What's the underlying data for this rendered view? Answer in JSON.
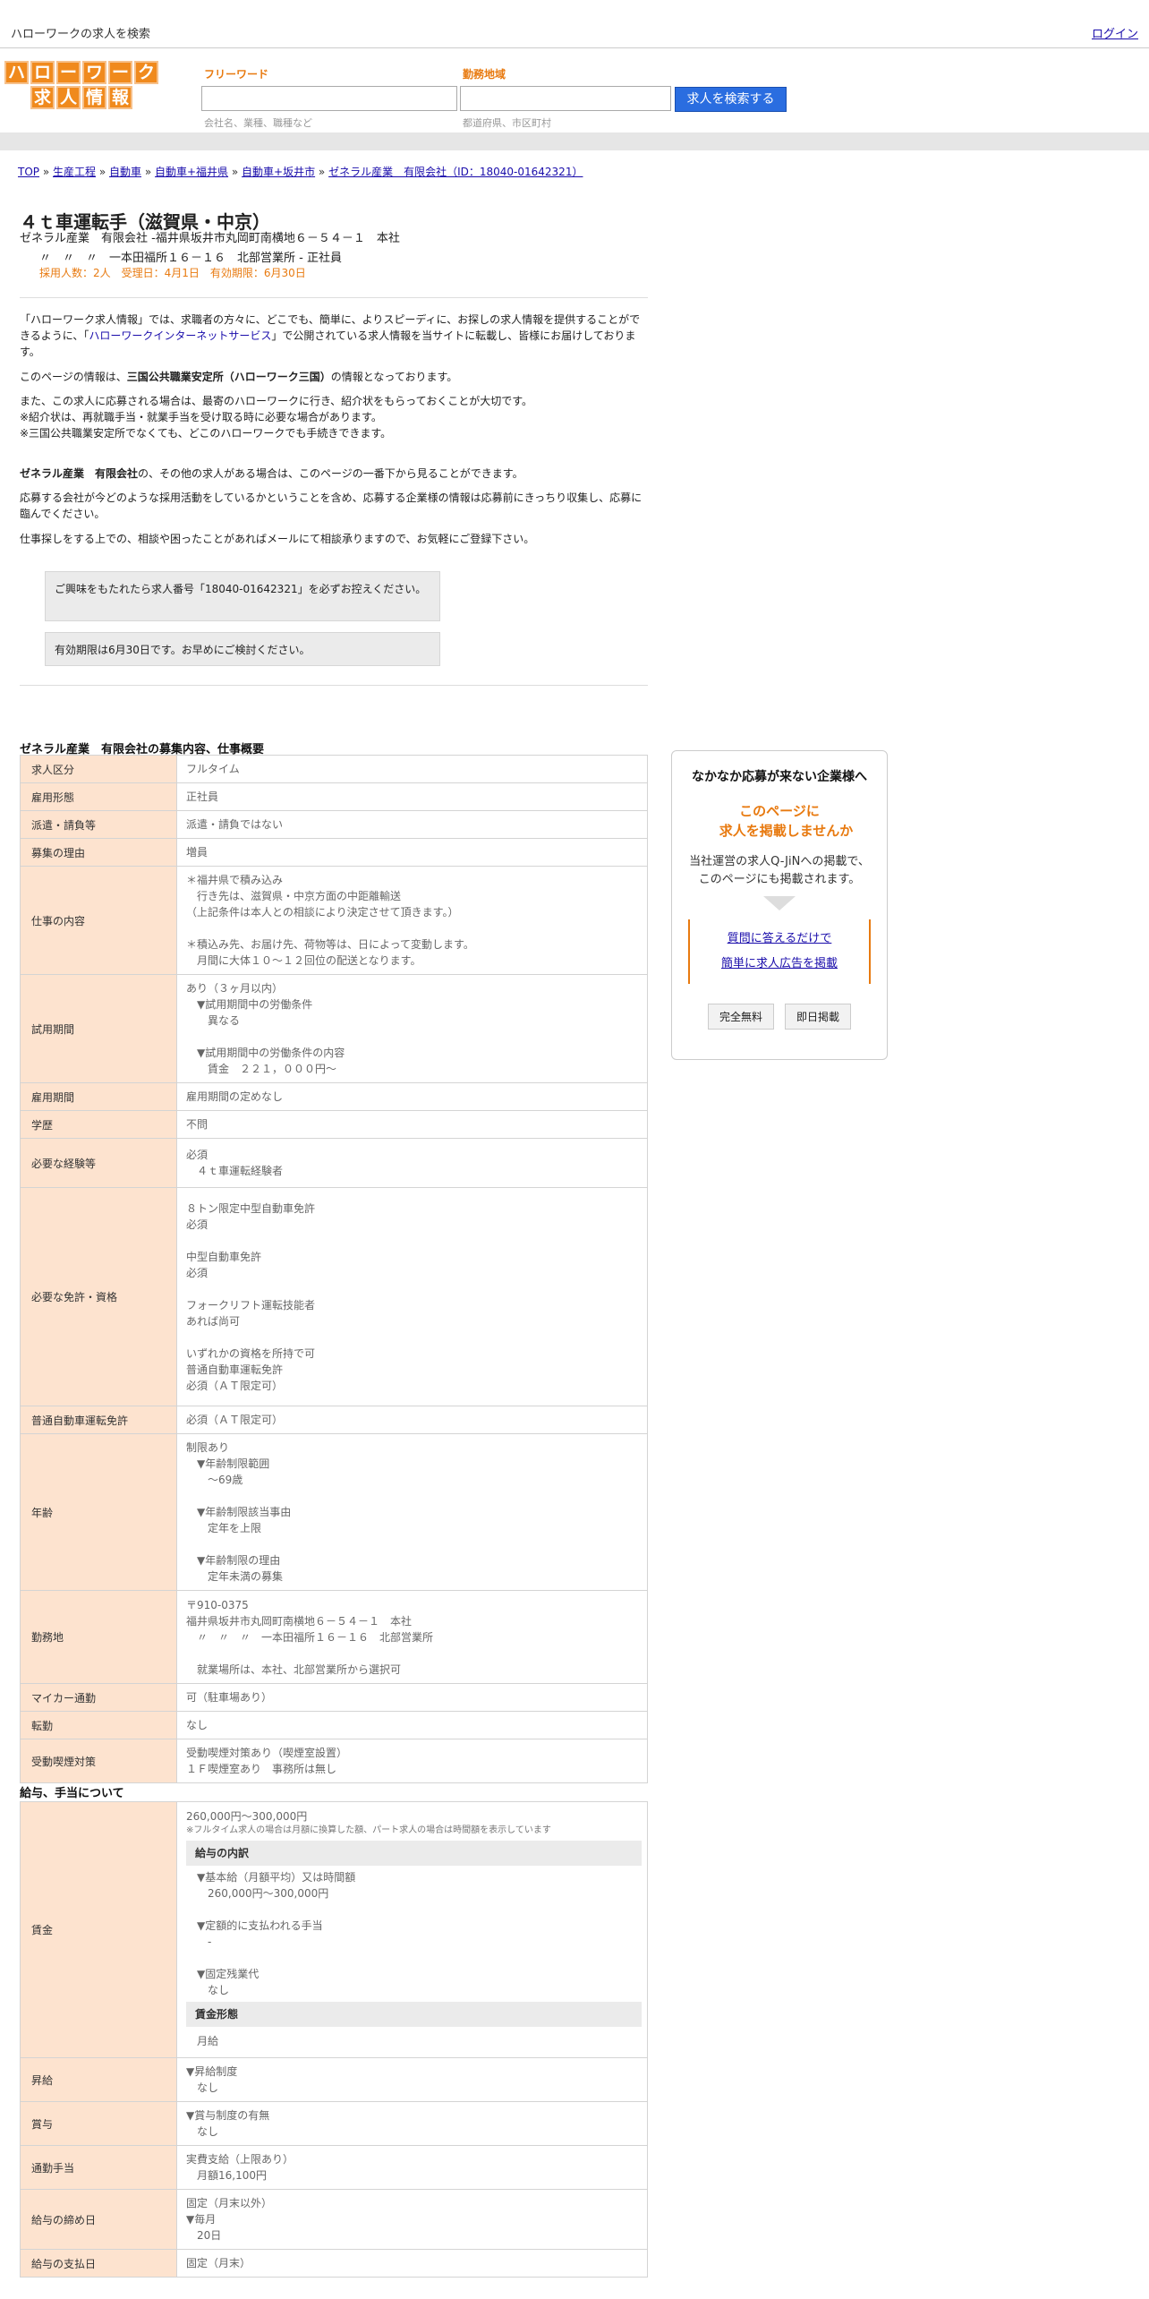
{
  "header": {
    "site_name": "ハローワークの求人を検索",
    "login": "ログイン"
  },
  "logo": {
    "row1": [
      "ハ",
      "ロ",
      "ー",
      "ワ",
      "ー",
      "ク"
    ],
    "row2": [
      "求",
      "人",
      "情",
      "報"
    ]
  },
  "search": {
    "keyword_label": "フリーワード",
    "keyword_hint": "会社名、業種、職種など",
    "area_label": "勤務地域",
    "area_hint": "都道府県、市区町村",
    "button": "求人を検索する"
  },
  "breadcrumb": {
    "items": [
      "TOP",
      "生産工程",
      "自動車",
      "自動車+福井県",
      "自動車+坂井市",
      "ゼネラル産業　有限会社（ID：18040-01642321）"
    ],
    "sep": " » "
  },
  "job": {
    "title": "４ｔ車運転手（滋賀県・中京）",
    "company_line": "ゼネラル産業　有限会社 -福井県坂井市丸岡町南横地６－５４－１　本社",
    "company_line2": "〃　〃　〃　一本田福所１６－１６　北部営業所 - 正社員",
    "meta": "採用人数：2人　受理日：4月1日　有効期限：6月30日"
  },
  "intro": {
    "p1a": "「ハローワーク求人情報」では、求職者の方々に、どこでも、簡単に、よりスピーディに、お探しの求人情報を提供することができるように、「",
    "p1_link": "ハローワークインターネットサービス",
    "p1b": "」で公開されている求人情報を当サイトに転載し、皆様にお届けしております。",
    "p2a": "このページの情報は、",
    "p2_bold": "三国公共職業安定所（ハローワーク三国）",
    "p2b": "の情報となっております。",
    "p3": "また、この求人に応募される場合は、最寄のハローワークに行き、紹介状をもらっておくことが大切です。\n※紹介状は、再就職手当・就業手当を受け取る時に必要な場合があります。\n※三国公共職業安定所でなくても、どこのハローワークでも手続きできます。",
    "p4_bold": "ゼネラル産業　有限会社",
    "p4b": "の、その他の求人がある場合は、このページの一番下から見ることができます。",
    "p5": "応募する会社が今どのような採用活動をしているかということを含め、応募する企業様の情報は応募前にきっちり収集し、応募に臨んでください。",
    "p6": "仕事探しをする上での、相談や困ったことがあればメールにて相談承りますので、お気軽にご登録下さい。",
    "note1": "ご興味をもたれたら求人番号「18040-01642321」を必ずお控えください。",
    "note2": "有効期限は6月30日です。お早めにご検討ください。"
  },
  "section1_title": "ゼネラル産業　有限会社の募集内容、仕事概要",
  "rows1": [
    {
      "k": "求人区分",
      "v": "フルタイム"
    },
    {
      "k": "雇用形態",
      "v": "正社員"
    },
    {
      "k": "派遣・請負等",
      "v": "派遣・請負ではない"
    },
    {
      "k": "募集の理由",
      "v": "増員"
    },
    {
      "k": "仕事の内容",
      "v": "＊福井県で積み込み\n　行き先は、滋賀県・中京方面の中距離輸送\n（上記条件は本人との相談により決定させて頂きます。）\n\n＊積込み先、お届け先、荷物等は、日によって変動します。\n　月間に大体１０～１２回位の配送となります。"
    },
    {
      "k": "試用期間",
      "v": "あり（３ヶ月以内）\n　▼試用期間中の労働条件\n　　異なる\n\n　▼試用期間中の労働条件の内容\n　　賃金　２２１，０００円～"
    },
    {
      "k": "雇用期間",
      "v": "雇用期間の定めなし"
    },
    {
      "k": "学歴",
      "v": "不問"
    },
    {
      "k": "必要な経験等",
      "v": "必須\n　４ｔ車運転経験者"
    },
    {
      "k": "必要な免許・資格",
      "v": "８トン限定中型自動車免許\n必須\n\n中型自動車免許\n必須\n\nフォークリフト運転技能者\nあれば尚可\n\nいずれかの資格を所持で可\n普通自動車運転免許\n必須（ＡＴ限定可）"
    },
    {
      "k": "普通自動車運転免許",
      "v": "必須（ＡＴ限定可）"
    },
    {
      "k": "年齢",
      "v": "制限あり\n　▼年齢制限範囲\n　　〜69歳\n\n　▼年齢制限該当事由\n　　定年を上限\n\n　▼年齢制限の理由\n　　定年未満の募集"
    },
    {
      "k": "勤務地",
      "v": "〒910-0375\n福井県坂井市丸岡町南横地６－５４－１　本社\n　〃　〃　〃　一本田福所１６－１６　北部営業所\n\n　就業場所は、本社、北部営業所から選択可"
    },
    {
      "k": "マイカー通勤",
      "v": "可（駐車場あり）"
    },
    {
      "k": "転勤",
      "v": "なし"
    },
    {
      "k": "受動喫煙対策",
      "v": "受動喫煙対策あり（喫煙室設置）\n１Ｆ喫煙室あり　事務所は無し"
    }
  ],
  "section2_title": "給与、手当について",
  "wage": {
    "k": "賃金",
    "amount": "260,000円〜300,000円",
    "note": "※フルタイム求人の場合は月額に換算した額、パート求人の場合は時間額を表示しています",
    "breakdown_title": "給与の内訳",
    "breakdown": "　▼基本給（月額平均）又は時間額\n　　260,000円〜300,000円\n\n　▼定額的に支払われる手当\n　　-\n\n　▼固定残業代\n　　なし",
    "form_title": "賃金形態",
    "form": "　月給"
  },
  "rows2": [
    {
      "k": "昇給",
      "v": "▼昇給制度\n　なし"
    },
    {
      "k": "賞与",
      "v": "▼賞与制度の有無\n　なし"
    },
    {
      "k": "通勤手当",
      "v": "実費支給（上限あり）\n　月額16,100円"
    },
    {
      "k": "給与の締め日",
      "v": "固定（月末以外）\n▼毎月\n　20日"
    },
    {
      "k": "給与の支払日",
      "v": "固定（月末）"
    }
  ],
  "sidebar": {
    "heading": "なかなか応募が来ない企業様へ",
    "offer": "このページに\n　求人を掲載しませんか",
    "desc": "当社運営の求人Q-JiNへの掲載で、\nこのページにも掲載されます。",
    "link1": "質問に答えるだけで",
    "link2": "簡単に求人広告を掲載",
    "btn1": "完全無料",
    "btn2": "即日掲載"
  }
}
